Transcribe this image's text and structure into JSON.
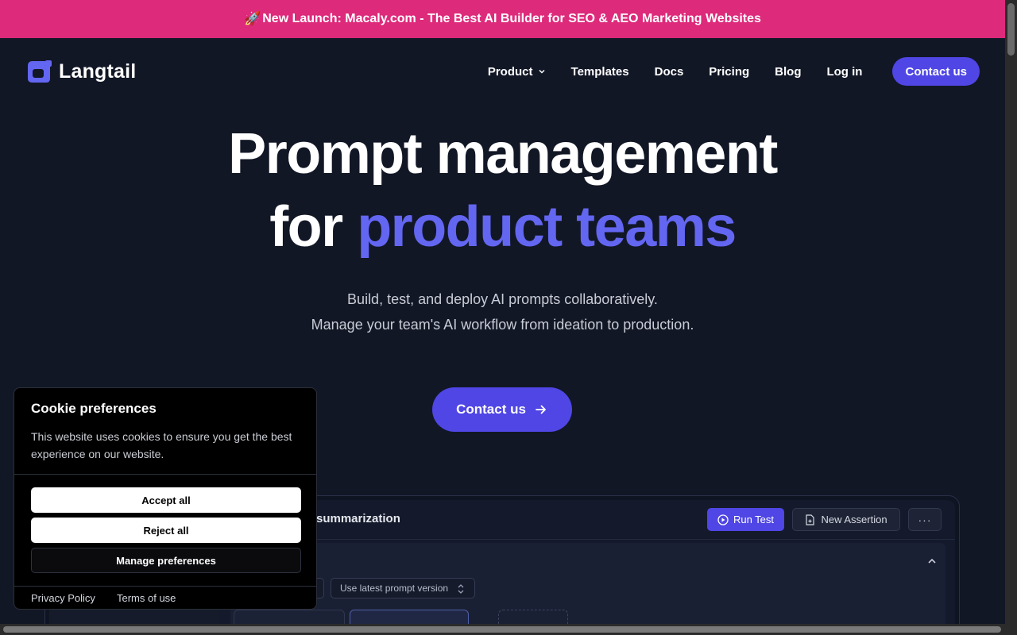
{
  "banner": {
    "icon": "rocket-icon",
    "text": "New Launch: Macaly.com - The Best AI Builder for SEO & AEO Marketing Websites",
    "color": "#dd2a7b"
  },
  "nav": {
    "logo_text": "Langtail",
    "links": [
      {
        "label": "Product",
        "dropdown": true
      },
      {
        "label": "Templates"
      },
      {
        "label": "Docs"
      },
      {
        "label": "Pricing"
      },
      {
        "label": "Blog"
      },
      {
        "label": "Log in"
      }
    ],
    "cta": "Contact us"
  },
  "hero": {
    "title_line1": "Prompt management",
    "title_line2_prefix": "for",
    "title_line2_accent": "product teams",
    "subtitle_line1": "Build, test, and deploy AI prompts collaboratively.",
    "subtitle_line2": "Manage your team's AI workflow from ideation to production.",
    "cta": "Contact us",
    "accent_color": "#6366f1"
  },
  "preview": {
    "title": "summarization",
    "run_test": "Run Test",
    "new_assertion": "New Assertion",
    "more": "···",
    "version_select": "Use latest prompt version"
  },
  "cookie": {
    "title": "Cookie preferences",
    "description": "This website uses cookies to ensure you get the best experience on our website.",
    "accept": "Accept all",
    "reject": "Reject all",
    "manage": "Manage preferences",
    "privacy": "Privacy Policy",
    "terms": "Terms of use"
  },
  "colors": {
    "background": "#121726",
    "primary": "#4f46e5"
  }
}
